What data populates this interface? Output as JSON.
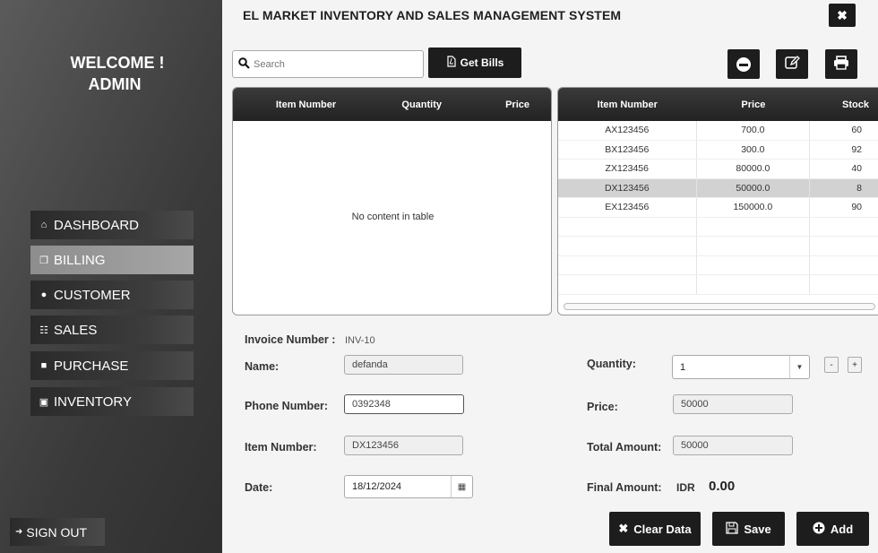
{
  "sidebar": {
    "welcome_line1": "WELCOME !",
    "welcome_line2": "ADMIN",
    "items": [
      {
        "label": "DASHBOARD",
        "icon": "home-icon"
      },
      {
        "label": "BILLING",
        "icon": "copy-icon",
        "active": true
      },
      {
        "label": "CUSTOMER",
        "icon": "user-icon"
      },
      {
        "label": "SALES",
        "icon": "cart-icon"
      },
      {
        "label": "PURCHASE",
        "icon": "briefcase-icon"
      },
      {
        "label": "INVENTORY",
        "icon": "boxes-icon"
      }
    ],
    "signout_label": "SIGN OUT"
  },
  "header": {
    "title": "EL MARKET INVENTORY AND SALES MANAGEMENT SYSTEM",
    "close_label": "✖"
  },
  "toolbar": {
    "search_placeholder": "Search",
    "get_bills_label": "Get Bills"
  },
  "bill_table": {
    "columns": [
      "Item Number",
      "Quantity",
      "Price"
    ],
    "empty_message": "No content in table"
  },
  "product_table": {
    "columns": [
      "Item Number",
      "Price",
      "Stock"
    ],
    "rows": [
      {
        "item": "AX123456",
        "price": "700.0",
        "stock": "60"
      },
      {
        "item": "BX123456",
        "price": "300.0",
        "stock": "92"
      },
      {
        "item": "ZX123456",
        "price": "80000.0",
        "stock": "40"
      },
      {
        "item": "DX123456",
        "price": "50000.0",
        "stock": "8",
        "selected": true
      },
      {
        "item": "EX123456",
        "price": "150000.0",
        "stock": "90"
      }
    ]
  },
  "form": {
    "invoice_label": "Invoice Number :",
    "invoice_value": "INV-10",
    "name_label": "Name:",
    "name_value": "defanda",
    "phone_label": "Phone Number:",
    "phone_value": "0392348",
    "item_label": "Item Number:",
    "item_value": "DX123456",
    "date_label": "Date:",
    "date_value": "18/12/2024",
    "quantity_label": "Quantity:",
    "quantity_value": "1",
    "price_label": "Price:",
    "price_value": "50000",
    "total_label": "Total Amount:",
    "total_value": "50000",
    "final_label": "Final Amount:",
    "final_currency": "IDR",
    "final_value": "0.00",
    "minus_label": "-",
    "plus_label": "+"
  },
  "actions": {
    "clear_label": "Clear Data",
    "save_label": "Save",
    "add_label": "Add"
  }
}
